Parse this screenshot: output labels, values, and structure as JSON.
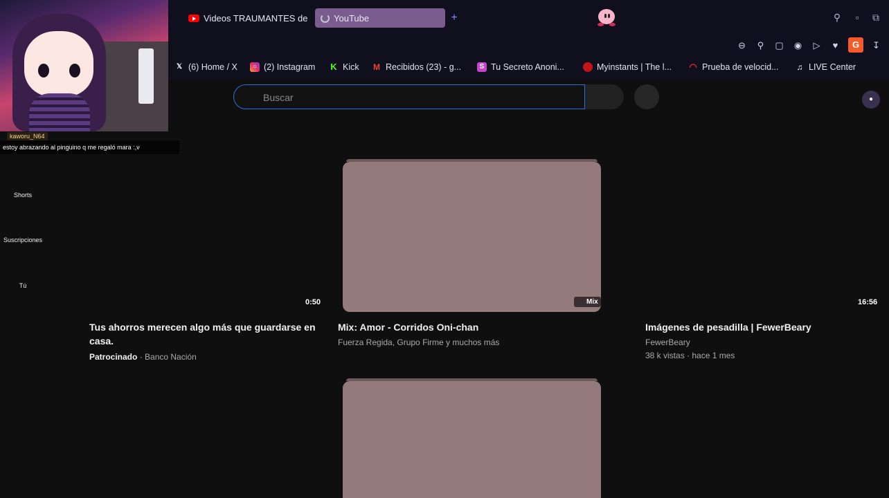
{
  "browser": {
    "tabs": [
      {
        "label": "Videos TRAUMANTES de",
        "icon": "youtube-icon",
        "active": false
      },
      {
        "label": "YouTube",
        "icon": "loading-spinner-icon",
        "active": true
      }
    ],
    "bookmarks": [
      {
        "label": "(6) Home / X",
        "icon": "x-icon"
      },
      {
        "label": "(2) Instagram",
        "icon": "instagram-icon"
      },
      {
        "label": "Kick",
        "icon": "kick-icon"
      },
      {
        "label": "Recibidos (23) - g...",
        "icon": "gmail-icon"
      },
      {
        "label": "Tu Secreto Anoni...",
        "icon": "secret-icon"
      },
      {
        "label": "Myinstants | The l...",
        "icon": "myinstants-icon"
      },
      {
        "label": "Prueba de velocid...",
        "icon": "speedtest-icon"
      },
      {
        "label": "LIVE Center",
        "icon": "tiktok-icon"
      }
    ],
    "extension_badge": "G"
  },
  "youtube": {
    "search_placeholder": "Buscar",
    "sidebar": [
      "Shorts",
      "Suscripciones",
      "Tú"
    ],
    "videos": [
      {
        "duration": "0:50",
        "title_line1": "Tus ahorros merecen algo más que guardarse en",
        "title_line2": "casa.",
        "sponsored": "Patrocinado",
        "advertiser": "Banco Nación"
      },
      {
        "badge": "Mix",
        "title": "Mix: Amor - Corridos Oni-chan",
        "channel": "Fuerza Regida, Grupo Firme y muchos más"
      },
      {
        "duration": "16:56",
        "title": "Imágenes de pesadilla | FewerBeary",
        "channel": "FewerBeary",
        "stats": "38 k vistas · hace 1 mes"
      }
    ]
  },
  "stream_overlay": {
    "username": "kaworu_N64",
    "chat_message": "estoy abrazando al pinguino q me regaló mara :,v"
  },
  "colors": {
    "thumbnail": "#957a7b",
    "search_border": "#2b6fdc",
    "active_tab": "#7a5c8e",
    "background": "#0f0f0f"
  }
}
